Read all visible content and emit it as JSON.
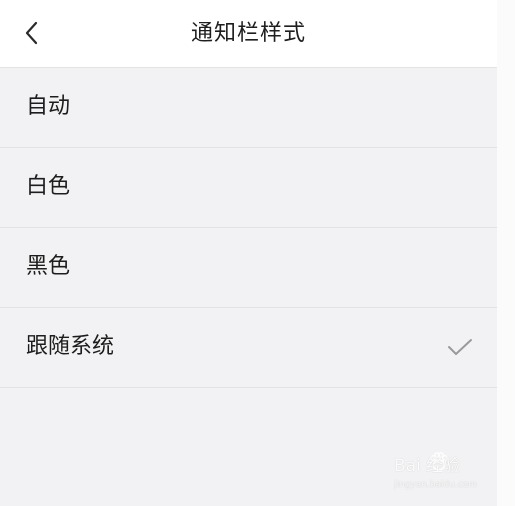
{
  "header": {
    "title": "通知栏样式",
    "back_icon": "chevron-left-icon"
  },
  "options": [
    {
      "label": "自动",
      "selected": false
    },
    {
      "label": "白色",
      "selected": false
    },
    {
      "label": "黑色",
      "selected": false
    },
    {
      "label": "跟随系统",
      "selected": true
    }
  ],
  "watermark": {
    "text": "Bai 经验",
    "url": "jingyan.baidu.com"
  },
  "colors": {
    "background": "#f2f2f4",
    "header_background": "#ffffff",
    "divider": "#e2e2e5",
    "text": "#1f1f1f",
    "check": "#9a9a9a"
  }
}
